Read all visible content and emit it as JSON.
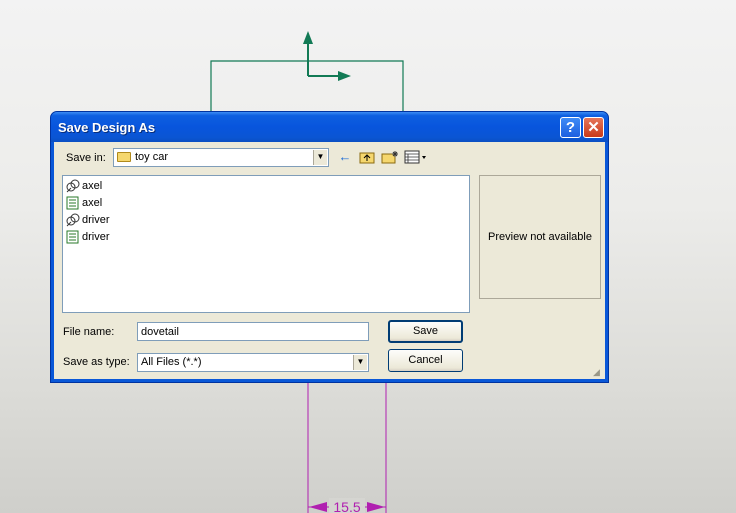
{
  "background": {
    "dimension_label": "15.5",
    "dimension_color": "#b020b0",
    "sketch_color": "#127a55"
  },
  "dialog": {
    "title": "Save Design As",
    "help_label": "?",
    "close_label": "✕",
    "save_in_label": "Save in:",
    "save_in_value": "toy car",
    "preview_text": "Preview not available",
    "files": [
      {
        "name": "axel",
        "icon": "assembly-icon"
      },
      {
        "name": "axel",
        "icon": "part-icon"
      },
      {
        "name": "driver",
        "icon": "assembly-icon"
      },
      {
        "name": "driver",
        "icon": "part-icon"
      }
    ],
    "file_name_label": "File name:",
    "file_name_value": "dovetail",
    "save_type_label": "Save as type:",
    "save_type_value": "All Files (*.*)",
    "save_button": "Save",
    "cancel_button": "Cancel",
    "toolbar": {
      "back": "←",
      "up": "⮤",
      "new_folder": "✱",
      "view_menu": "▦▾"
    }
  }
}
